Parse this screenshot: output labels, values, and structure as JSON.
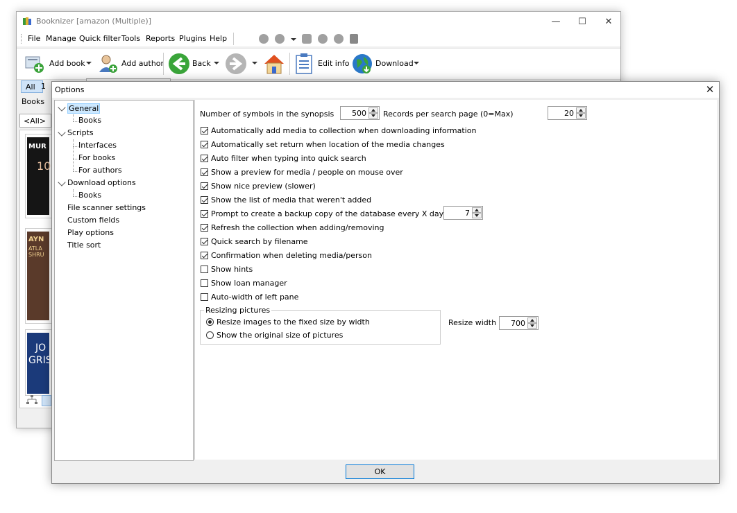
{
  "main_window": {
    "title": "Booknizer [amazon (Multiple)]",
    "menu": [
      "File",
      "Manage",
      "Quick filter",
      "Tools",
      "Reports",
      "Plugins",
      "Help"
    ],
    "toolbar": {
      "add_book": "Add book",
      "add_author": "Add author",
      "back": "Back",
      "edit_info": "Edit info",
      "download": "Download"
    },
    "filter_tabs": [
      "All",
      "1"
    ],
    "books_tab": "Books",
    "all_filter": "<All>",
    "book_covers": [
      {
        "text": "MUR",
        "sub": "10",
        "bg": "#1a1a1a",
        "fg": "#ffffff"
      },
      {
        "text": "AYN",
        "sub": "ATLA SHRU",
        "bg": "#5a3a2a",
        "fg": "#f0d090"
      },
      {
        "text": "JO",
        "sub": "GRIS",
        "bg": "#1b3a7a",
        "fg": "#ffffff"
      }
    ]
  },
  "dialog": {
    "title": "Options",
    "tree": [
      {
        "label": "General",
        "level": 0,
        "expanded": true,
        "selected": true
      },
      {
        "label": "Books",
        "level": 1
      },
      {
        "label": "Scripts",
        "level": 0,
        "expanded": true
      },
      {
        "label": "Interfaces",
        "level": 1
      },
      {
        "label": "For books",
        "level": 1
      },
      {
        "label": "For authors",
        "level": 1
      },
      {
        "label": "Download options",
        "level": 0,
        "expanded": true
      },
      {
        "label": "Books",
        "level": 1
      },
      {
        "label": "File scanner settings",
        "level": 0
      },
      {
        "label": "Custom fields",
        "level": 0
      },
      {
        "label": "Play options",
        "level": 0
      },
      {
        "label": "Title sort",
        "level": 0
      }
    ],
    "synopsis_label": "Number of symbols in the synopsis",
    "synopsis_value": "500",
    "records_label": "Records per search page (0=Max)",
    "records_value": "20",
    "checkboxes": [
      {
        "label": "Automatically add media to collection when downloading information",
        "checked": true
      },
      {
        "label": "Automatically set return when location of the media changes",
        "checked": true
      },
      {
        "label": "Auto filter when typing into quick search",
        "checked": true
      },
      {
        "label": "Show a preview for media / people on mouse over",
        "checked": true
      },
      {
        "label": "Show nice preview (slower)",
        "checked": true
      },
      {
        "label": "Show the list of media that weren't added",
        "checked": true
      },
      {
        "label": "Prompt to create a backup copy of the database every X days:",
        "checked": true
      },
      {
        "label": "Refresh the collection when adding/removing",
        "checked": true
      },
      {
        "label": "Quick search by filename",
        "checked": true
      },
      {
        "label": "Confirmation when deleting media/person",
        "checked": true
      },
      {
        "label": "Show hints",
        "checked": false
      },
      {
        "label": "Show loan manager",
        "checked": false
      },
      {
        "label": "Auto-width of left pane",
        "checked": false
      }
    ],
    "backup_days": "7",
    "resize_group": {
      "title": "Resizing pictures",
      "options": [
        {
          "label": "Resize images to the fixed size by width",
          "selected": true
        },
        {
          "label": "Show the original size of pictures",
          "selected": false
        }
      ],
      "width_label": "Resize width",
      "width_value": "700"
    },
    "ok_label": "OK"
  }
}
